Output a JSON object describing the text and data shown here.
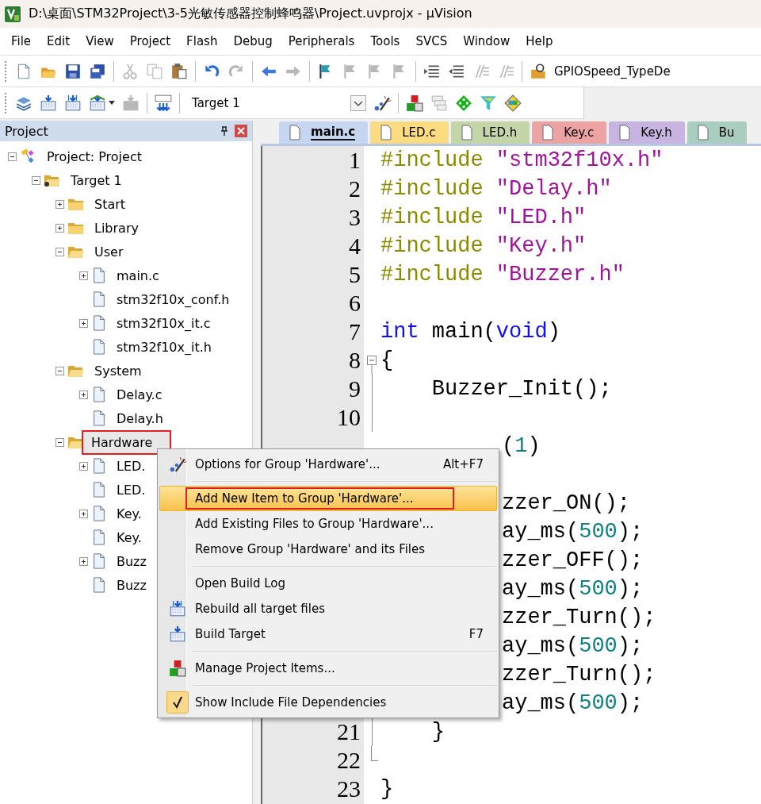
{
  "window": {
    "title": "D:\\桌面\\STM32Project\\3-5光敏传感器控制蜂鸣器\\Project.uvprojx - µVision"
  },
  "menu_bar": [
    "File",
    "Edit",
    "View",
    "Project",
    "Flash",
    "Debug",
    "Peripherals",
    "Tools",
    "SVCS",
    "Window",
    "Help"
  ],
  "toolbar_1": {
    "groups": [
      [
        {
          "kind": "new-file",
          "disabled": false
        },
        {
          "kind": "open-folder",
          "disabled": false
        },
        {
          "kind": "save",
          "disabled": false
        },
        {
          "kind": "save-all",
          "disabled": false
        }
      ],
      [
        {
          "kind": "cut",
          "disabled": true
        },
        {
          "kind": "copy",
          "disabled": true
        },
        {
          "kind": "paste",
          "disabled": false
        }
      ],
      [
        {
          "kind": "undo",
          "disabled": false
        },
        {
          "kind": "redo",
          "disabled": true
        }
      ],
      [
        {
          "kind": "back",
          "disabled": false
        },
        {
          "kind": "forward",
          "disabled": true
        }
      ],
      [
        {
          "kind": "flag",
          "disabled": false
        },
        {
          "kind": "flag-prev",
          "disabled": true
        },
        {
          "kind": "flag-next",
          "disabled": true
        },
        {
          "kind": "flag-clear",
          "disabled": true
        }
      ],
      [
        {
          "kind": "indent",
          "disabled": false
        },
        {
          "kind": "unindent",
          "disabled": false
        },
        {
          "kind": "comment",
          "disabled": true
        },
        {
          "kind": "uncomment",
          "disabled": true
        }
      ],
      [
        {
          "kind": "find",
          "disabled": false
        }
      ]
    ],
    "find_text": "GPIOSpeed_TypeDe"
  },
  "toolbar_2": {
    "groups": [
      [
        {
          "kind": "translate",
          "disabled": false
        },
        {
          "kind": "build",
          "disabled": false
        },
        {
          "kind": "rebuild",
          "disabled": false
        },
        {
          "kind": "batch",
          "disabled": false
        },
        {
          "kind": "stop",
          "disabled": true
        }
      ],
      [
        {
          "kind": "load",
          "disabled": false
        }
      ]
    ],
    "target": "Target 1",
    "groups_after": [
      [
        {
          "kind": "wand",
          "disabled": false
        }
      ],
      [
        {
          "kind": "blocks",
          "disabled": false
        },
        {
          "kind": "books",
          "disabled": true
        },
        {
          "kind": "diamond",
          "disabled": false
        },
        {
          "kind": "funnel",
          "disabled": false
        },
        {
          "kind": "packs",
          "disabled": false
        }
      ]
    ]
  },
  "project_panel": {
    "title": "Project",
    "tree": [
      {
        "label": "Project: Project",
        "kind": "project",
        "expanded": true,
        "children": [
          {
            "label": "Target 1",
            "kind": "target",
            "expanded": true,
            "children": [
              {
                "label": "Start",
                "kind": "folder",
                "expanded": false
              },
              {
                "label": "Library",
                "kind": "folder",
                "expanded": false
              },
              {
                "label": "User",
                "kind": "folder",
                "expanded": true,
                "children": [
                  {
                    "label": "main.c",
                    "kind": "file",
                    "expanded": false
                  },
                  {
                    "label": "stm32f10x_conf.h",
                    "kind": "file"
                  },
                  {
                    "label": "stm32f10x_it.c",
                    "kind": "file",
                    "expanded": false
                  },
                  {
                    "label": "stm32f10x_it.h",
                    "kind": "file"
                  }
                ]
              },
              {
                "label": "System",
                "kind": "folder",
                "expanded": true,
                "children": [
                  {
                    "label": "Delay.c",
                    "kind": "file",
                    "expanded": false
                  },
                  {
                    "label": "Delay.h",
                    "kind": "file"
                  }
                ]
              },
              {
                "label": "Hardware",
                "kind": "folder",
                "expanded": true,
                "selected": true,
                "outlined": true,
                "children": [
                  {
                    "label": "LED.",
                    "kind": "file",
                    "expanded": false
                  },
                  {
                    "label": "LED.",
                    "kind": "file"
                  },
                  {
                    "label": "Key.",
                    "kind": "file",
                    "expanded": false
                  },
                  {
                    "label": "Key.",
                    "kind": "file"
                  },
                  {
                    "label": "Buzz",
                    "kind": "file",
                    "expanded": false
                  },
                  {
                    "label": "Buzz",
                    "kind": "file"
                  }
                ]
              }
            ]
          }
        ]
      }
    ]
  },
  "tabs": [
    {
      "label": "main.c",
      "selected": true,
      "color": "#c6d6f0"
    },
    {
      "label": "LED.c",
      "selected": false,
      "color": "#fbdc80"
    },
    {
      "label": "LED.h",
      "selected": false,
      "color": "#c4d6a8"
    },
    {
      "label": "Key.c",
      "selected": false,
      "color": "#eda3a3"
    },
    {
      "label": "Key.h",
      "selected": false,
      "color": "#c8b4e0"
    },
    {
      "label": "Bu",
      "selected": false,
      "color": "#a9cdbf"
    }
  ],
  "code": [
    {
      "kind": "line",
      "number": "1",
      "tokens": [
        {
          "kind": "directive",
          "text": "#include "
        },
        {
          "kind": "string",
          "text": "\"stm32f10x.h\""
        }
      ]
    },
    {
      "kind": "line",
      "number": "2",
      "tokens": [
        {
          "kind": "directive",
          "text": "#include "
        },
        {
          "kind": "string",
          "text": "\"Delay.h\""
        }
      ]
    },
    {
      "kind": "line",
      "number": "3",
      "tokens": [
        {
          "kind": "directive",
          "text": "#include "
        },
        {
          "kind": "string",
          "text": "\"LED.h\""
        }
      ]
    },
    {
      "kind": "line",
      "number": "4",
      "tokens": [
        {
          "kind": "directive",
          "text": "#include "
        },
        {
          "kind": "string",
          "text": "\"Key.h\""
        }
      ]
    },
    {
      "kind": "line",
      "number": "5",
      "tokens": [
        {
          "kind": "directive",
          "text": "#include "
        },
        {
          "kind": "string",
          "text": "\"Buzzer.h\""
        }
      ]
    },
    {
      "kind": "line",
      "number": "6"
    },
    {
      "kind": "line",
      "number": "7",
      "tokens": [
        {
          "kind": "keyword",
          "text": "int"
        },
        {
          "kind": "plain",
          "text": " main("
        },
        {
          "kind": "keyword",
          "text": "void"
        },
        {
          "kind": "plain",
          "text": ")"
        }
      ]
    },
    {
      "kind": "fold-start",
      "number": "8",
      "tokens": [
        {
          "kind": "plain",
          "text": "{"
        }
      ]
    },
    {
      "kind": "fold-body",
      "number": "9",
      "tokens": [
        {
          "kind": "plain",
          "text": "    Buzzer_Init();"
        }
      ]
    },
    {
      "kind": "fold-body",
      "number": "10"
    },
    {
      "kind": "covered",
      "tokens": [
        {
          "kind": "plain",
          "text": "("
        },
        {
          "kind": "number",
          "text": "1"
        },
        {
          "kind": "plain",
          "text": ")"
        }
      ]
    },
    {
      "kind": "covered"
    },
    {
      "kind": "covered",
      "tokens": [
        {
          "kind": "plain",
          "text": "zzer_ON();"
        }
      ]
    },
    {
      "kind": "covered",
      "tokens": [
        {
          "kind": "plain",
          "text": "ay_ms("
        },
        {
          "kind": "number",
          "text": "500"
        },
        {
          "kind": "plain",
          "text": ");"
        }
      ]
    },
    {
      "kind": "covered",
      "tokens": [
        {
          "kind": "plain",
          "text": "zzer_OFF();"
        }
      ]
    },
    {
      "kind": "covered",
      "tokens": [
        {
          "kind": "plain",
          "text": "ay_ms("
        },
        {
          "kind": "number",
          "text": "500"
        },
        {
          "kind": "plain",
          "text": ");"
        }
      ]
    },
    {
      "kind": "covered",
      "tokens": [
        {
          "kind": "plain",
          "text": "zzer_Turn();"
        }
      ]
    },
    {
      "kind": "covered",
      "tokens": [
        {
          "kind": "plain",
          "text": "ay_ms("
        },
        {
          "kind": "number",
          "text": "500"
        },
        {
          "kind": "plain",
          "text": ");"
        }
      ]
    },
    {
      "kind": "covered",
      "tokens": [
        {
          "kind": "plain",
          "text": "zzer_Turn();"
        }
      ]
    },
    {
      "kind": "covered",
      "tokens": [
        {
          "kind": "plain",
          "text": "ay_ms("
        },
        {
          "kind": "number",
          "text": "500"
        },
        {
          "kind": "plain",
          "text": ");"
        }
      ]
    },
    {
      "kind": "fold-body",
      "number": "21",
      "tokens": [
        {
          "kind": "plain",
          "text": "    }"
        }
      ]
    },
    {
      "kind": "fold-end",
      "number": "22"
    },
    {
      "kind": "line",
      "number": "23",
      "tokens": [
        {
          "kind": "plain",
          "text": "}"
        }
      ]
    }
  ],
  "context_menu": [
    {
      "kind": "item",
      "label": "Options for Group 'Hardware'...",
      "shortcut": "Alt+F7",
      "highlighted": false
    },
    {
      "kind": "separator"
    },
    {
      "kind": "item",
      "label": "Add New  Item to Group 'Hardware'...",
      "highlighted": true,
      "outlined": true
    },
    {
      "kind": "item",
      "label": "Add Existing Files to Group 'Hardware'...",
      "highlighted": false
    },
    {
      "kind": "item",
      "label": "Remove Group 'Hardware' and its Files",
      "highlighted": false
    },
    {
      "kind": "separator"
    },
    {
      "kind": "item",
      "label": "Open Build Log",
      "highlighted": false
    },
    {
      "kind": "item",
      "label": "Rebuild all target files",
      "highlighted": false
    },
    {
      "kind": "item",
      "label": "Build Target",
      "shortcut": "F7",
      "highlighted": false
    },
    {
      "kind": "separator"
    },
    {
      "kind": "item",
      "label": "Manage Project Items...",
      "highlighted": false
    },
    {
      "kind": "separator"
    },
    {
      "kind": "item",
      "label": "Show Include File Dependencies",
      "highlighted": false,
      "checked": true
    }
  ]
}
